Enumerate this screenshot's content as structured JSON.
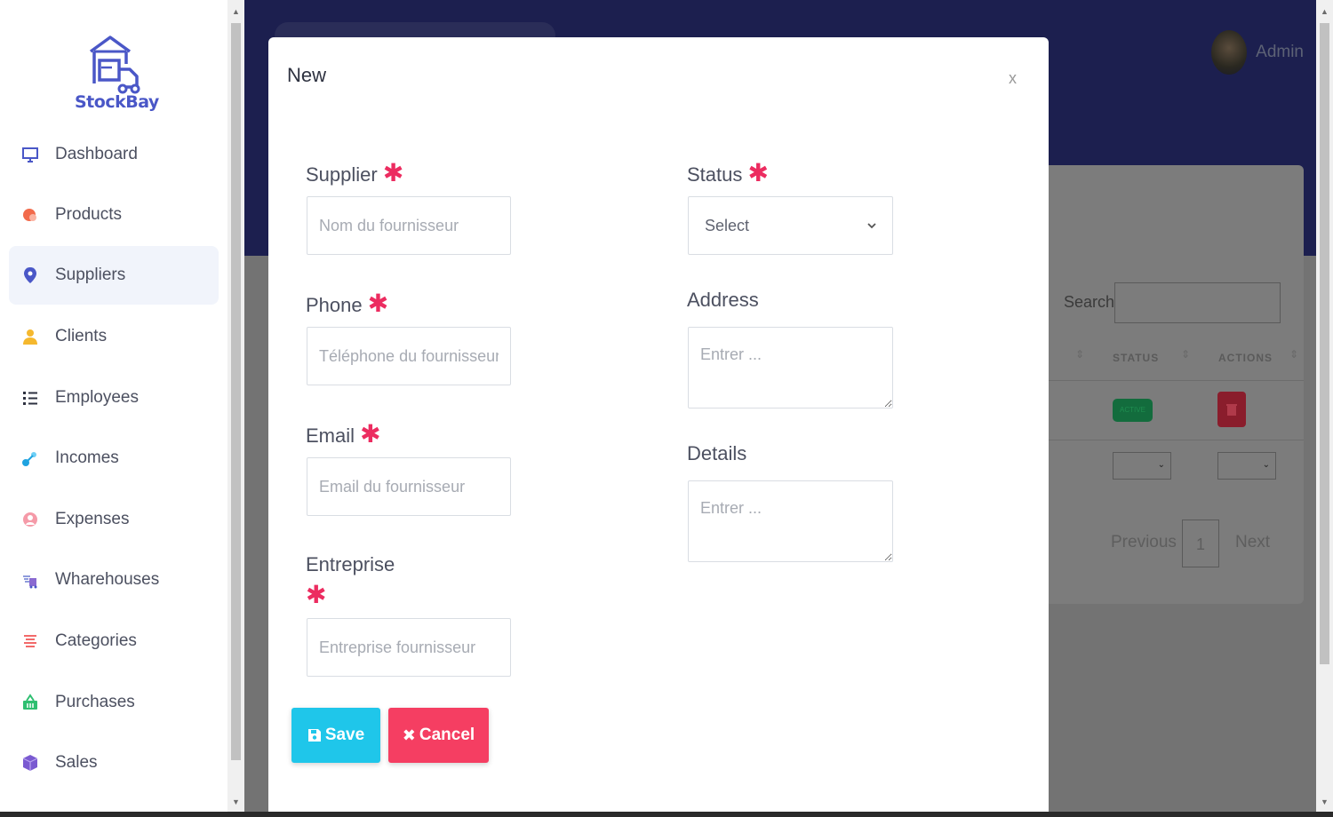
{
  "app": {
    "logo_text": "StockBay"
  },
  "sidebar": {
    "items": [
      {
        "label": "Dashboard",
        "icon": "monitor-icon",
        "active": false
      },
      {
        "label": "Products",
        "icon": "products-icon",
        "active": false
      },
      {
        "label": "Suppliers",
        "icon": "map-pin-icon",
        "active": true
      },
      {
        "label": "Clients",
        "icon": "user-icon",
        "active": false
      },
      {
        "label": "Employees",
        "icon": "list-icon",
        "active": false
      },
      {
        "label": "Incomes",
        "icon": "incomes-icon",
        "active": false
      },
      {
        "label": "Expenses",
        "icon": "expenses-icon",
        "active": false
      },
      {
        "label": "Wharehouses",
        "icon": "warehouse-icon",
        "active": false
      },
      {
        "label": "Categories",
        "icon": "categories-icon",
        "active": false
      },
      {
        "label": "Purchases",
        "icon": "basket-icon",
        "active": false
      },
      {
        "label": "Sales",
        "icon": "box-icon",
        "active": false
      }
    ]
  },
  "header": {
    "user_name": "Admin"
  },
  "background_table": {
    "search_label": "Search:",
    "columns": [
      "STATUS",
      "ACTIONS"
    ],
    "row_status": "ACTIVE",
    "pager": {
      "previous": "Previous",
      "page": "1",
      "next": "Next"
    }
  },
  "modal": {
    "title": "New",
    "close": "x",
    "fields": {
      "supplier": {
        "label": "Supplier",
        "placeholder": "Nom du fournisseur",
        "value": ""
      },
      "phone": {
        "label": "Phone",
        "placeholder": "Téléphone du fournisseur",
        "value": ""
      },
      "email": {
        "label": "Email",
        "placeholder": "Email du fournisseur",
        "value": ""
      },
      "entreprise": {
        "label": "Entreprise",
        "placeholder": "Entreprise fournisseur",
        "value": ""
      },
      "status": {
        "label": "Status",
        "selected": "Select"
      },
      "address": {
        "label": "Address",
        "placeholder": "Entrer ..."
      },
      "details": {
        "label": "Details",
        "placeholder": "Entrer ..."
      }
    },
    "required_mark": "✱",
    "save_label": "Save",
    "cancel_label": "Cancel"
  },
  "colors": {
    "brand": "#4a57c7",
    "save": "#1fc6ea",
    "cancel": "#f53e62",
    "required": "#ec2c60",
    "header_band": "#1c1f4f"
  }
}
